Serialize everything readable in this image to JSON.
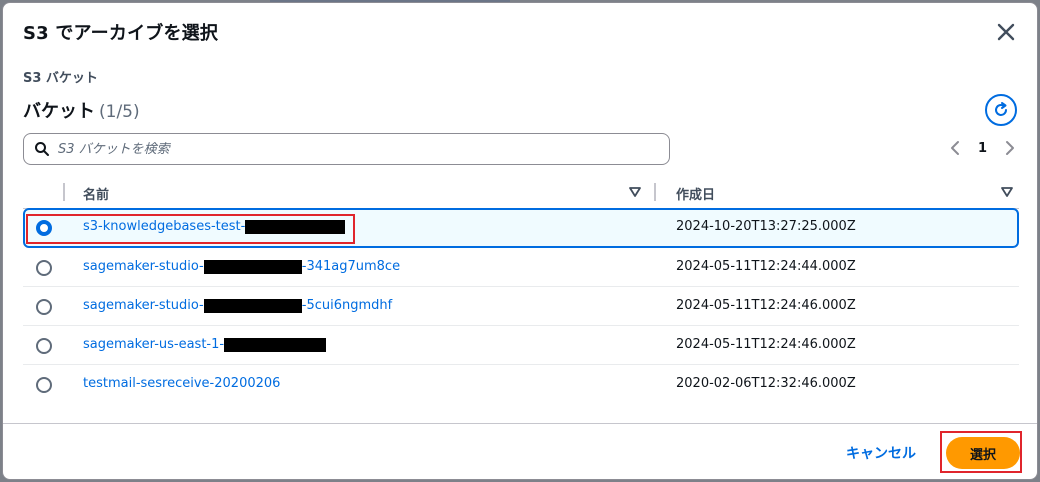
{
  "modal": {
    "title": "S3 でアーカイブを選択",
    "section_label": "S3 バケット",
    "heading": "バケット",
    "count": "(1/5)",
    "search_placeholder": "S3 バケットを検索",
    "page_number": "1"
  },
  "table": {
    "columns": [
      "名前",
      "作成日"
    ],
    "rows": [
      {
        "name_prefix": "s3-knowledgebases-test-",
        "name_suffix": "",
        "date": "2024-10-20T13:27:25.000Z",
        "selected": true
      },
      {
        "name_prefix": "sagemaker-studio-",
        "name_suffix": "-341ag7um8ce",
        "date": "2024-05-11T12:24:44.000Z",
        "selected": false
      },
      {
        "name_prefix": "sagemaker-studio-",
        "name_suffix": "-5cui6ngmdhf",
        "date": "2024-05-11T12:24:46.000Z",
        "selected": false
      },
      {
        "name_prefix": "sagemaker-us-east-1-",
        "name_suffix": "",
        "date": "2024-05-11T12:24:46.000Z",
        "selected": false
      },
      {
        "name_prefix": "testmail-sesreceive-20200206",
        "name_suffix": "",
        "date": "2020-02-06T12:32:46.000Z",
        "selected": false
      }
    ]
  },
  "footer": {
    "cancel_label": "キャンセル",
    "select_label": "選択"
  },
  "colors": {
    "link": "#006ce0",
    "primary_button": "#ff9900",
    "highlight": "#e0252c"
  },
  "icons": [
    "close-icon",
    "refresh-icon",
    "search-icon",
    "chevron-left-icon",
    "chevron-right-icon",
    "sort-down-icon"
  ]
}
